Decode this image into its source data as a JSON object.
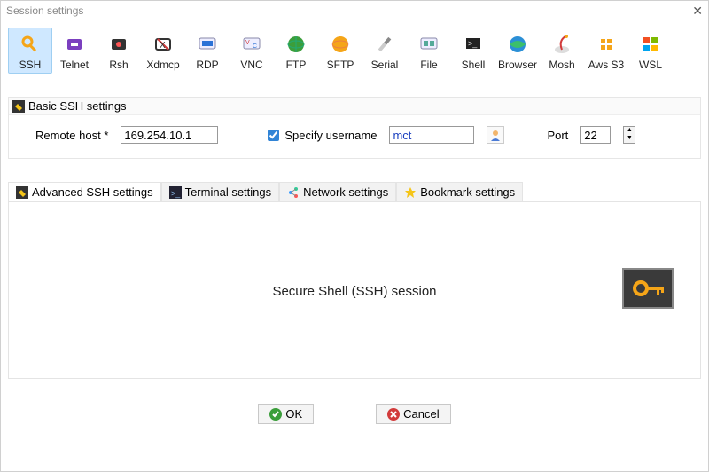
{
  "window": {
    "title": "Session settings"
  },
  "sessionTypes": [
    {
      "label": "SSH",
      "selected": true
    },
    {
      "label": "Telnet"
    },
    {
      "label": "Rsh"
    },
    {
      "label": "Xdmcp"
    },
    {
      "label": "RDP"
    },
    {
      "label": "VNC"
    },
    {
      "label": "FTP"
    },
    {
      "label": "SFTP"
    },
    {
      "label": "Serial"
    },
    {
      "label": "File"
    },
    {
      "label": "Shell"
    },
    {
      "label": "Browser"
    },
    {
      "label": "Mosh"
    },
    {
      "label": "Aws S3"
    },
    {
      "label": "WSL"
    }
  ],
  "basicPanel": {
    "title": "Basic SSH settings",
    "remoteHostLabel": "Remote host *",
    "remoteHostValue": "169.254.10.1",
    "specifyUsernameLabel": "Specify username",
    "specifyUsernameChecked": true,
    "usernameValue": "mct",
    "portLabel": "Port",
    "portValue": "22"
  },
  "tabs": [
    {
      "label": "Advanced SSH settings",
      "icon": "tool-icon"
    },
    {
      "label": "Terminal settings",
      "icon": "terminal-icon"
    },
    {
      "label": "Network settings",
      "icon": "network-icon"
    },
    {
      "label": "Bookmark settings",
      "icon": "star-icon"
    }
  ],
  "sessionDescription": "Secure Shell (SSH) session",
  "buttons": {
    "ok": "OK",
    "cancel": "Cancel"
  }
}
